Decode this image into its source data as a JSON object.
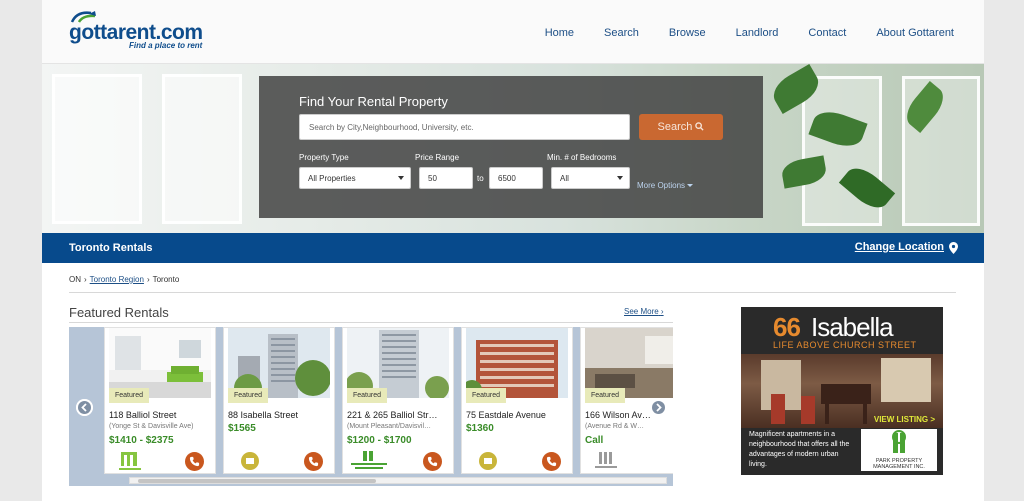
{
  "header": {
    "logo_text": "gottarent",
    "logo_suffix": ".com",
    "tagline": "Find a place to rent",
    "nav": [
      "Home",
      "Search",
      "Browse",
      "Landlord",
      "Contact",
      "About Gottarent"
    ]
  },
  "search": {
    "title": "Find Your Rental Property",
    "placeholder": "Search by City,Neighbourhood, University, etc.",
    "button_label": "Search",
    "property_type_label": "Property Type",
    "property_type_value": "All Properties",
    "price_label": "Price Range",
    "price_min": "50",
    "price_to": "to",
    "price_max": "6500",
    "bedrooms_label": "Min. # of Bedrooms",
    "bedrooms_value": "All",
    "more_options": "More Options"
  },
  "location_bar": {
    "city": "Toronto Rentals",
    "change_label": "Change Location"
  },
  "breadcrumb": {
    "province": "ON",
    "region": "Toronto Region",
    "city": "Toronto"
  },
  "featured": {
    "title": "Featured Rentals",
    "see_more": "See More",
    "badge": "Featured",
    "cards": [
      {
        "address": "118 Balliol Street",
        "sub": "(Yonge St & Davisville Ave)",
        "price": "$1410 - $2375"
      },
      {
        "address": "88 Isabella Street",
        "sub": "",
        "price": "$1565"
      },
      {
        "address": "221 & 265 Balliol Str…",
        "sub": "(Mount Pleasant/Davisvil…",
        "price": "$1200 - $1700"
      },
      {
        "address": "75 Eastdale Avenue",
        "sub": "",
        "price": "$1360"
      },
      {
        "address": "166 Wilson Av…",
        "sub": "(Avenue Rd & W…",
        "price": "Call"
      }
    ]
  },
  "ad": {
    "number": "66",
    "brand": "Isabella",
    "slogan": "LIFE ABOVE CHURCH STREET",
    "view_listing": "VIEW LISTING >",
    "copy": "Magnificent apartments in a neighbourhood that offers all the advantages of modern urban living.",
    "company": "PARK PROPERTY MANAGEMENT INC."
  },
  "colors": {
    "brand_blue": "#074a8c",
    "accent_orange": "#c96831",
    "price_green": "#3a8c29"
  }
}
